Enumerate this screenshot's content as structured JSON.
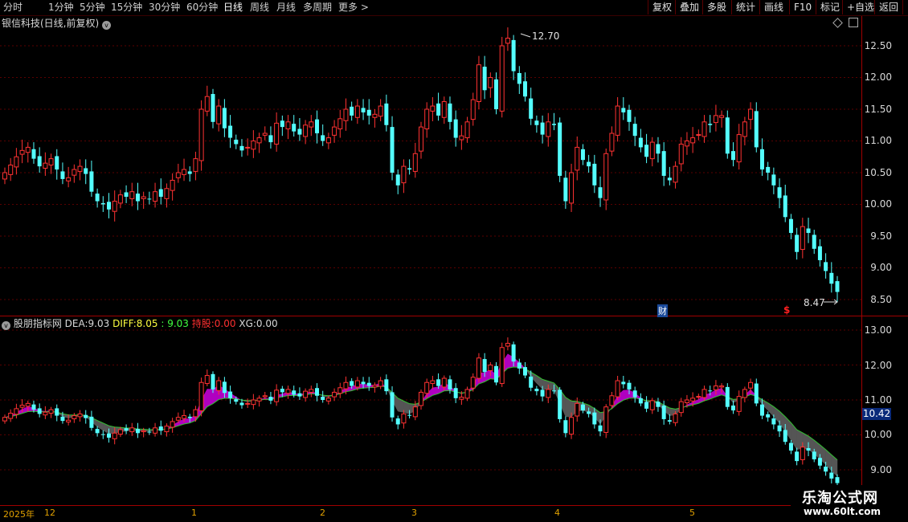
{
  "toolbar": {
    "periods": [
      "分时",
      "1分钟",
      "5分钟",
      "15分钟",
      "30分钟",
      "60分钟",
      "日线",
      "周线",
      "月线",
      "多周期",
      "更多 >"
    ],
    "active_period": "日线",
    "buttons": [
      "复权",
      "叠加",
      "多股",
      "统计",
      "画线",
      "F10",
      "标记",
      "+自选",
      "返回"
    ]
  },
  "main_pane": {
    "title": "银信科技(日线,前复权)",
    "y_labels": [
      "12.50",
      "12.00",
      "11.50",
      "11.00",
      "10.50",
      "10.00",
      "9.50",
      "9.00",
      "8.50"
    ],
    "high_label": "12.70",
    "low_label": "8.47",
    "markers": {
      "cai": "财",
      "s": "$"
    }
  },
  "indicator_pane": {
    "name": "股朋指标网",
    "dea_label": "DEA:",
    "dea_value": "9.03",
    "diff_label": "DIFF:",
    "diff_value": "8.05",
    "third_value": ": 9.03",
    "hold_label": "持股:",
    "hold_value": "0.00",
    "xg_label": "XG:",
    "xg_value": "0.00",
    "y_labels": [
      "13.00",
      "12.00",
      "11.00",
      "10.00",
      "9.00"
    ],
    "cursor_value": "10.42"
  },
  "time_axis": {
    "labels": [
      "2025年",
      "12",
      "1",
      "2",
      "3",
      "4",
      "5"
    ]
  },
  "watermark": {
    "line1": "乐淘公式网",
    "line2": "www.60lt.com"
  },
  "colors": {
    "up": "#ff3232",
    "down": "#54ffff",
    "band_up": "#b000c0",
    "band_down": "#555555",
    "grid": "#8a0000"
  },
  "chart_data": {
    "type": "candlestick",
    "closes": [
      10.5,
      10.62,
      10.75,
      10.85,
      10.9,
      10.72,
      10.6,
      10.65,
      10.72,
      10.55,
      10.4,
      10.42,
      10.55,
      10.6,
      10.48,
      10.2,
      10.05,
      10.0,
      9.92,
      10.05,
      10.15,
      10.12,
      10.2,
      10.05,
      10.12,
      10.08,
      10.2,
      10.12,
      10.25,
      10.38,
      10.5,
      10.55,
      10.48,
      10.72,
      11.5,
      11.7,
      11.3,
      11.55,
      11.2,
      11.05,
      10.95,
      10.85,
      10.9,
      11.0,
      11.05,
      11.12,
      10.98,
      11.28,
      11.22,
      11.3,
      11.15,
      11.1,
      11.25,
      11.3,
      11.12,
      11.0,
      11.05,
      11.22,
      11.35,
      11.5,
      11.4,
      11.55,
      11.45,
      11.4,
      11.42,
      11.55,
      11.25,
      10.5,
      10.3,
      10.6,
      10.55,
      10.8,
      11.22,
      11.5,
      11.55,
      11.4,
      11.62,
      11.3,
      11.05,
      11.08,
      11.3,
      11.65,
      12.2,
      11.8,
      12.0,
      11.5,
      12.5,
      12.62,
      12.1,
      11.9,
      11.7,
      11.35,
      11.25,
      11.1,
      11.3,
      11.25,
      10.45,
      10.05,
      10.5,
      10.9,
      10.7,
      10.6,
      10.3,
      10.1,
      10.8,
      11.12,
      11.55,
      11.45,
      11.3,
      11.08,
      10.9,
      10.75,
      10.98,
      10.8,
      10.45,
      10.38,
      10.6,
      10.95,
      11.0,
      11.05,
      11.1,
      11.3,
      11.25,
      11.4,
      11.4,
      10.8,
      10.7,
      11.1,
      11.3,
      11.5,
      10.9,
      10.55,
      10.5,
      10.3,
      10.1,
      9.8,
      9.55,
      9.25,
      9.65,
      9.55,
      9.3,
      9.12,
      8.95,
      8.75,
      8.62
    ],
    "y_range": [
      8.3,
      12.8
    ]
  }
}
